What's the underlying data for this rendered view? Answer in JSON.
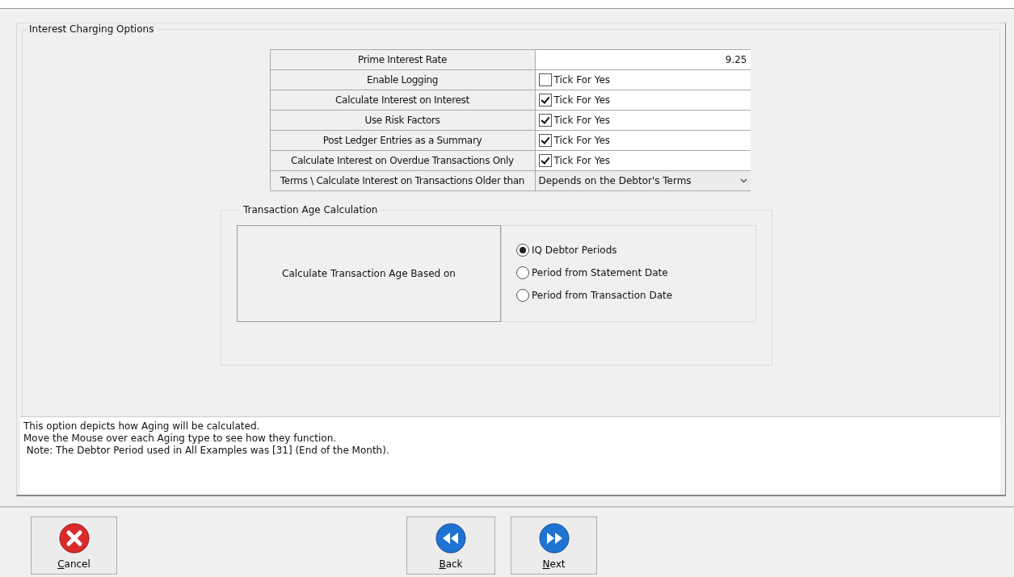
{
  "options_group": {
    "title": "Interest Charging Options",
    "settings": [
      {
        "kind": "number",
        "label": "Prime Interest Rate",
        "value": "9.25"
      },
      {
        "kind": "checkbox",
        "label": "Enable Logging",
        "text": "Tick For Yes",
        "checked": false
      },
      {
        "kind": "checkbox",
        "label": "Calculate Interest on Interest",
        "text": "Tick For Yes",
        "checked": true
      },
      {
        "kind": "checkbox",
        "label": "Use Risk Factors",
        "text": "Tick For Yes",
        "checked": true
      },
      {
        "kind": "checkbox",
        "label": "Post Ledger Entries as a Summary",
        "text": "Tick For Yes",
        "checked": true
      },
      {
        "kind": "checkbox",
        "label": "Calculate Interest on Overdue Transactions Only",
        "text": "Tick For Yes",
        "checked": true
      },
      {
        "kind": "select",
        "label": "Terms \\ Calculate Interest on Transactions Older than",
        "value": "Depends on the Debtor's Terms"
      }
    ],
    "age_group": {
      "title": "Transaction Age Calculation",
      "label": "Calculate Transaction Age Based on",
      "options": [
        {
          "label": "IQ Debtor Periods",
          "selected": true
        },
        {
          "label": "Period from Statement Date",
          "selected": false
        },
        {
          "label": "Period from Transaction Date",
          "selected": false
        }
      ]
    }
  },
  "description": [
    "This option depicts how Aging will be calculated.",
    "Move the Mouse over each Aging type to see how they function.",
    " Note: The Debtor Period used in All Examples was [31] (End of the Month)."
  ],
  "buttons": [
    {
      "kind": "cancel",
      "label": "Cancel"
    },
    {
      "kind": "back",
      "label": "Back"
    },
    {
      "kind": "next",
      "label": "Next"
    }
  ]
}
